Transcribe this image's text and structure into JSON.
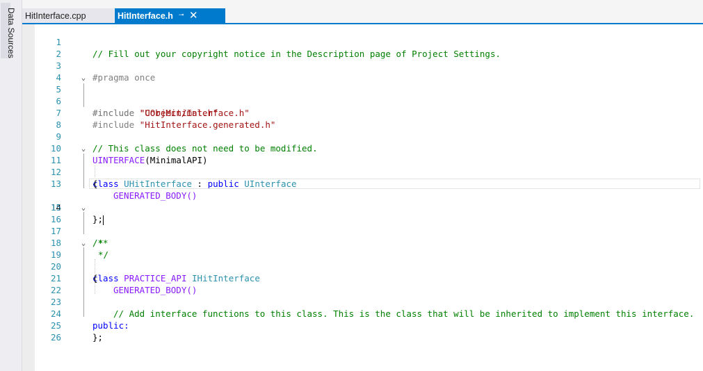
{
  "side_panel": {
    "label": "Data Sources"
  },
  "tabs": [
    {
      "label": "HitInterface.cpp",
      "active": false
    },
    {
      "label": "HitInterface.h",
      "active": true,
      "pin": "⊸",
      "close": "✕"
    }
  ],
  "editor": {
    "current_line": 14,
    "lines": [
      {
        "n": "1",
        "text": "// Fill out your copyright notice in the Description page of Project Settings."
      },
      {
        "n": "2",
        "text": ""
      },
      {
        "n": "3",
        "text": "#pragma once"
      },
      {
        "n": "4",
        "text": ""
      },
      {
        "n": "5",
        "text": "#include \"CoreMinimal.h\""
      },
      {
        "n": "6",
        "text": "#include \"UObject/Interface.h\""
      },
      {
        "n": "7",
        "text": "#include \"HitInterface.generated.h\""
      },
      {
        "n": "8",
        "text": ""
      },
      {
        "n": "9",
        "text": "// This class does not need to be modified."
      },
      {
        "n": "10",
        "text": "UINTERFACE(MinimalAPI)"
      },
      {
        "n": "11",
        "text": "class UHitInterface : public UInterface"
      },
      {
        "n": "12",
        "text": "{"
      },
      {
        "n": "13",
        "text": "GENERATED_BODY()"
      },
      {
        "n": "14",
        "text": "};"
      },
      {
        "n": "15",
        "text": ""
      },
      {
        "n": "16",
        "text": "/**"
      },
      {
        "n": "17",
        "text": "*"
      },
      {
        "n": "18",
        "text": "*/"
      },
      {
        "n": "19",
        "text": "class PRACTICE_API IHitInterface"
      },
      {
        "n": "20",
        "text": "{"
      },
      {
        "n": "21",
        "text": "GENERATED_BODY()"
      },
      {
        "n": "22",
        "text": ""
      },
      {
        "n": "23",
        "text": "// Add interface functions to this class. This is the class that will be inherited to implement this interface."
      },
      {
        "n": "24",
        "text": "public:"
      },
      {
        "n": "25",
        "text": "};"
      },
      {
        "n": "26",
        "text": ""
      }
    ]
  },
  "colors": {
    "accent": "#007acc",
    "comment": "#008000",
    "keyword": "#0000ff",
    "type": "#2b91af",
    "string": "#a31515",
    "macro": "#8a1bff",
    "line_number": "#2b91af"
  },
  "icons": {
    "fold": "chevron-down-icon",
    "pin": "pin-icon",
    "close": "close-icon"
  }
}
